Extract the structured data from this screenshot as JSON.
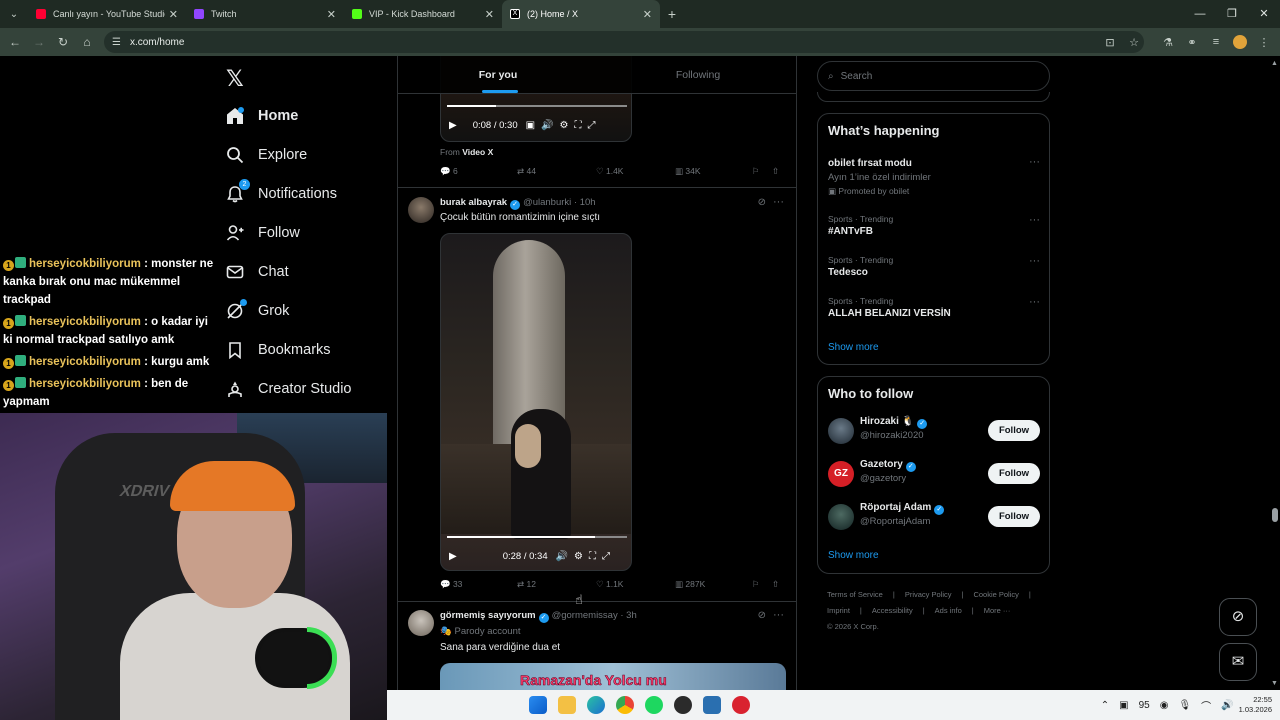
{
  "browser": {
    "tabs": [
      {
        "label": "Canlı yayın - YouTube Studio",
        "color": "#ff0033",
        "active": false
      },
      {
        "label": "Twitch",
        "color": "#9146ff",
        "active": false
      },
      {
        "label": "VIP - Kick Dashboard",
        "color": "#53fc18",
        "active": false
      },
      {
        "label": "(2) Home / X",
        "color": "#ffffff",
        "active": true
      }
    ],
    "url": "x.com/home"
  },
  "chat": [
    {
      "user": "herseyicokbiliyorum",
      "sep": ":",
      "message": "monster ne kanka bırak onu mac mükemmel trackpad"
    },
    {
      "user": "herseyicokbiliyorum",
      "sep": ":",
      "message": "o kadar iyi ki normal trackpad satılıyo amk"
    },
    {
      "user": "herseyicokbiliyorum",
      "sep": ":",
      "message": "kurgu amk"
    },
    {
      "user": "herseyicokbiliyorum",
      "sep": ":",
      "message": "ben de yapmam"
    }
  ],
  "chat_badge": "1",
  "webcam": {
    "chair_brand": "XDRIV"
  },
  "nav": {
    "logo": "𝕏",
    "items": [
      {
        "label": "Home",
        "icon": "home-icon"
      },
      {
        "label": "Explore",
        "icon": "search-icon"
      },
      {
        "label": "Notifications",
        "icon": "bell-icon",
        "badge": "2"
      },
      {
        "label": "Follow",
        "icon": "person-plus-icon"
      },
      {
        "label": "Chat",
        "icon": "envelope-icon"
      },
      {
        "label": "Grok",
        "icon": "grok-icon"
      },
      {
        "label": "Bookmarks",
        "icon": "bookmark-icon"
      },
      {
        "label": "Creator Studio",
        "icon": "creator-icon"
      }
    ]
  },
  "timeline": {
    "tabs": [
      "For you",
      "Following"
    ],
    "tweet1": {
      "video_time": "0:08 / 0:30",
      "video_progress": 0.27,
      "from_label": "From",
      "from_source": "Video X",
      "replies": "6",
      "reposts": "44",
      "likes": "1.4K",
      "views": "34K"
    },
    "tweet2": {
      "name": "burak albayrak",
      "handle": "@ulanburki",
      "time": "· 10h",
      "text": "Çocuk bütün romantizimin içine sıçtı",
      "video_time": "0:28 / 0:34",
      "video_progress": 0.82,
      "replies": "33",
      "reposts": "12",
      "likes": "1.1K",
      "views": "287K"
    },
    "tweet3": {
      "name": "görmemiş sayıyorum",
      "handle": "@gormemissay",
      "time": "· 3h",
      "parody": "Parody account",
      "text": "Sana para verdiğine dua et",
      "image_caption": "Ramazan'da Yolcu mu"
    }
  },
  "sidebar": {
    "search_placeholder": "Search",
    "happening": {
      "title": "What’s happening",
      "trends": [
        {
          "meta": "",
          "title": "obilet fırsat modu",
          "sub": "Ayın 1’ine özel indirimler",
          "promo": "Promoted by obilet"
        },
        {
          "meta": "Sports · Trending",
          "title": "#ANTvFB",
          "sub": "",
          "promo": ""
        },
        {
          "meta": "Sports · Trending",
          "title": "Tedesco",
          "sub": "",
          "promo": ""
        },
        {
          "meta": "Sports · Trending",
          "title": "ALLAH BELANIZI VERSİN",
          "sub": "",
          "promo": ""
        }
      ],
      "show_more": "Show more"
    },
    "who_to_follow": {
      "title": "Who to follow",
      "users": [
        {
          "name": "Hirozaki 🐧",
          "handle": "@hirozaki2020",
          "button": "Follow",
          "color": "#2a3b4a"
        },
        {
          "name": "Gazetory",
          "handle": "@gazetory",
          "button": "Follow",
          "color": "#d51f26"
        },
        {
          "name": "Röportaj Adam",
          "handle": "@RoportajAdam",
          "button": "Follow",
          "color": "#1f3a3a"
        }
      ],
      "show_more": "Show more"
    },
    "footer": [
      "Terms of Service",
      "|",
      "Privacy Policy",
      "|",
      "Cookie Policy",
      "|",
      "Imprint",
      "|",
      "Accessibility",
      "|",
      "Ads info",
      "|",
      "More ···",
      "© 2026 X Corp."
    ]
  },
  "taskbar": {
    "tray_number": "95",
    "time": "22:55",
    "date": "1.03.2026"
  }
}
